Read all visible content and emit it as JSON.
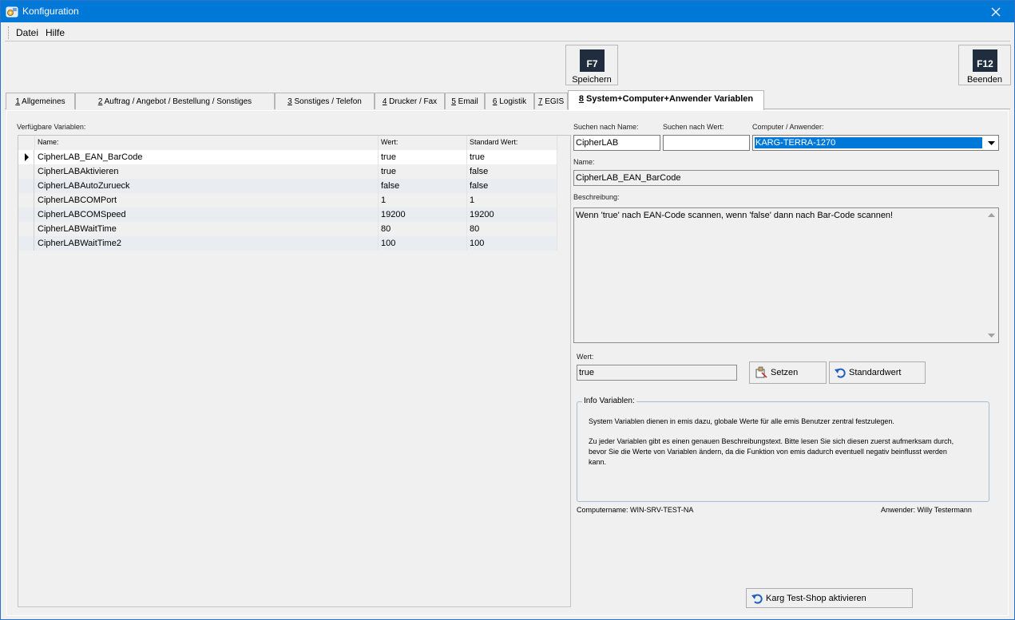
{
  "window": {
    "title": "Konfiguration"
  },
  "menu": {
    "file": "Datei",
    "help": "Hilfe"
  },
  "toolbar": {
    "save": {
      "key": "F7",
      "label": "Speichern"
    },
    "exit": {
      "key": "F12",
      "label": "Beenden"
    }
  },
  "tabs": [
    {
      "num": "1",
      "label": "Allgemeines"
    },
    {
      "num": "2",
      "label": "Auftrag / Angebot / Bestellung / Sonstiges"
    },
    {
      "num": "3",
      "label": "Sonstiges / Telefon"
    },
    {
      "num": "4",
      "label": "Drucker / Fax"
    },
    {
      "num": "5",
      "label": "Email"
    },
    {
      "num": "6",
      "label": "Logistik"
    },
    {
      "num": "7",
      "label": "EGIS"
    },
    {
      "num": "8",
      "label": "System+Computer+Anwender Variablen"
    }
  ],
  "variables": {
    "label": "Verfügbare Variablen:",
    "columns": [
      "Name:",
      "Wert:",
      "Standard Wert:"
    ],
    "rows": [
      [
        "CipherLAB_EAN_BarCode",
        "true",
        "true"
      ],
      [
        "CipherLABAktivieren",
        "true",
        "false"
      ],
      [
        "CipherLABAutoZurueck",
        "false",
        "false"
      ],
      [
        "CipherLABCOMPort",
        "1",
        "1"
      ],
      [
        "CipherLABCOMSpeed",
        "19200",
        "19200"
      ],
      [
        "CipherLABWaitTime",
        "80",
        "80"
      ],
      [
        "CipherLABWaitTime2",
        "100",
        "100"
      ]
    ]
  },
  "search": {
    "name_label": "Suchen nach Name:",
    "name_value": "CipherLAB",
    "value_label": "Suchen nach Wert:",
    "value_value": "",
    "computer_label": "Computer / Anwender:",
    "computer_value": "KARG-TERRA-1270"
  },
  "detail": {
    "name_label": "Name:",
    "name_value": "CipherLAB_EAN_BarCode",
    "desc_label": "Beschreibung:",
    "desc_value": "Wenn 'true' nach EAN-Code scannen, wenn 'false' dann nach Bar-Code scannen!",
    "value_label": "Wert:",
    "value_value": "true",
    "set_button": "Setzen",
    "default_button": "Standardwert"
  },
  "info": {
    "legend": "Info Variablen:",
    "para1": "System Variablen dienen in emis dazu, globale Werte für alle emis Benutzer zentral festzulegen.",
    "para2": "Zu jeder Variablen gibt es einen genauen Beschreibungstext. Bitte lesen Sie sich diesen zuerst aufmerksam durch, bevor Sie die Werte von Variablen ändern, da die Funktion von emis dadurch eventuell negativ beinflusst werden kann."
  },
  "footer": {
    "computer": "Computername: WIN-SRV-TEST-NA",
    "user": "Anwender: Willy Testermann"
  },
  "shop_button": "Karg Test-Shop aktivieren",
  "colors": {
    "titlebar": "#0078d7",
    "selection": "#0078d7",
    "key_bg": "#1f2d3e"
  }
}
